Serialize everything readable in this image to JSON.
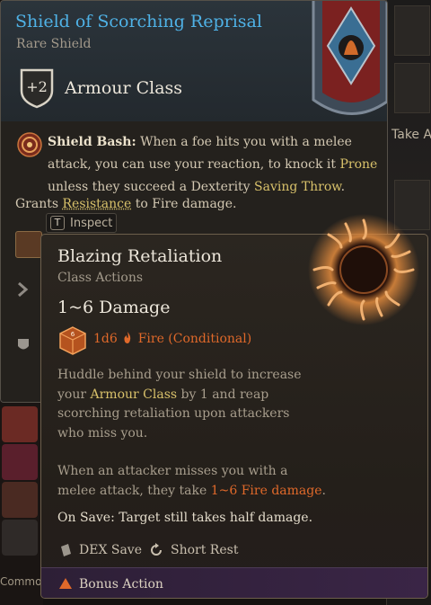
{
  "colors": {
    "title_blue": "#4fb2e6",
    "keyword_gold": "#d8c16a",
    "fire_orange": "#e0692a",
    "footer_purple": "#3a2546"
  },
  "background": {
    "take_all_label": "Take A",
    "common_label": "Commo"
  },
  "item_tooltip": {
    "title": "Shield of Scorching Reprisal",
    "rarity": "Rare Shield",
    "armour_class_value": "+2",
    "armour_class_label": "Armour Class",
    "shield_bash": {
      "icon": "shield-bash-icon",
      "name": "Shield Bash:",
      "text_a": " When a foe hits you with a melee attack, you can use your reaction, to knock it ",
      "prone": "Prone",
      "text_b": " unless they succeed a Dexterity ",
      "saving_throw": "Saving Throw",
      "text_c": "."
    },
    "grants": {
      "prefix": "Grants ",
      "resistance": "Resistance",
      "suffix": " to Fire damage."
    },
    "inspect_key": "T",
    "inspect_label": "Inspect"
  },
  "action_tooltip": {
    "title": "Blazing Retaliation",
    "category": "Class Actions",
    "damage": "1~6 Damage",
    "dice_roll": "1d6",
    "damage_type": "Fire (Conditional)",
    "description_a": "Huddle behind your shield to increase your ",
    "armour_class_link": "Armour Class",
    "description_b": " by 1 and reap scorching retaliation upon attackers who miss you.",
    "description2_a": "When an attacker misses you with a melee attack, they take ",
    "fire_damage": "1~6 Fire damage",
    "description2_b": ".",
    "on_save": "On Save: Target still takes half damage.",
    "save_type": "DEX Save",
    "recharge": "Short Rest",
    "cost": "Bonus Action",
    "icon": "blazing-sun-icon"
  }
}
